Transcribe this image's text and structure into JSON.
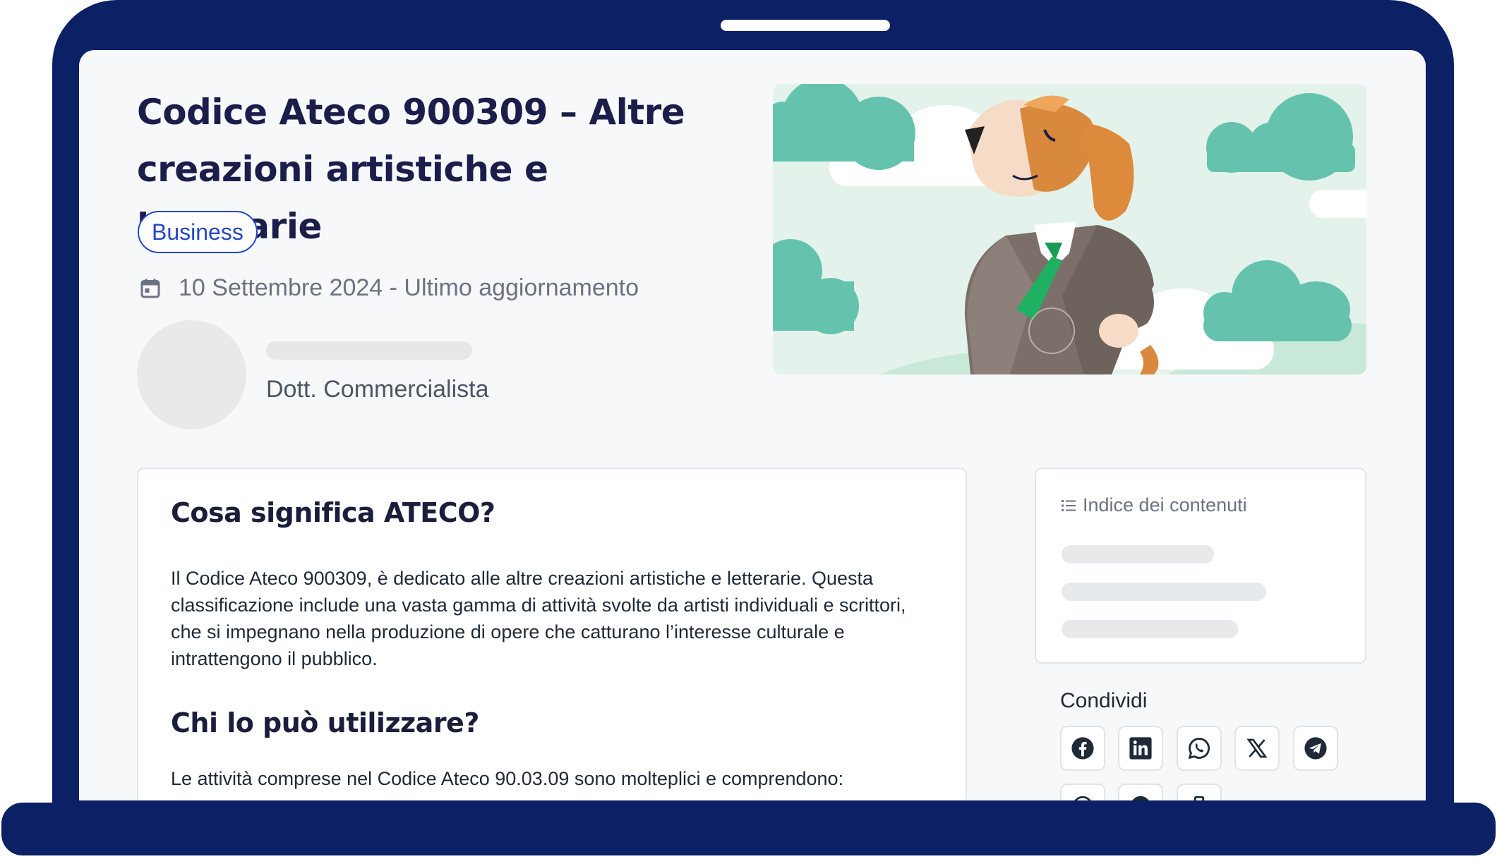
{
  "article": {
    "title": "Codice Ateco 900309 – Altre creazioni artistiche e letterarie",
    "category": "Business",
    "date_text": "10 Settembre 2024 - Ultimo aggiornamento",
    "author_role": "Dott. Commercialista"
  },
  "content": {
    "section1_heading": "Cosa significa ATECO?",
    "section1_text": "Il Codice Ateco 900309, è dedicato alle altre creazioni artistiche e letterarie. Questa classificazione include una vasta gamma di attività svolte da artisti individuali e scrittori, che si impegnano nella produzione di opere che catturano l’interesse culturale e intrattengono il pubblico.",
    "section2_heading": "Chi lo può utilizzare?",
    "section2_text": "Le attività comprese nel Codice Ateco 90.03.09 sono molteplici e comprendono:"
  },
  "sidebar": {
    "toc_title": "Indice dei contenuti",
    "share_title": "Condividi",
    "share_icons": [
      "facebook-icon",
      "linkedin-icon",
      "whatsapp-icon",
      "x-icon",
      "telegram-icon"
    ]
  },
  "colors": {
    "frame": "#0b2065",
    "accent": "#2447c8",
    "title": "#1b1e4b",
    "cloud": "#65c3ad"
  }
}
